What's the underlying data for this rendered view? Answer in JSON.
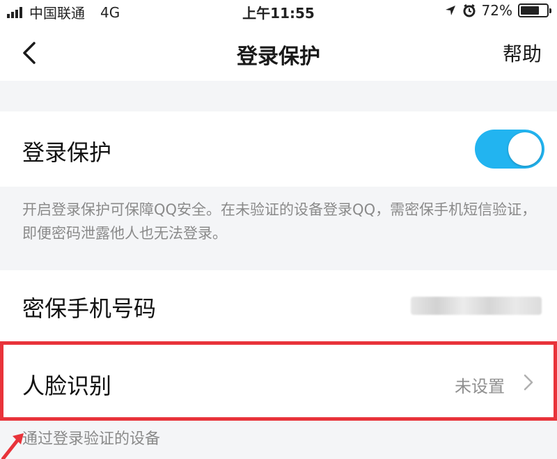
{
  "status": {
    "carrier": "中国联通",
    "network": "4G",
    "time": "上午11:55",
    "battery": "72%",
    "battery_level": 72
  },
  "nav": {
    "title": "登录保护",
    "help": "帮助"
  },
  "login_protect": {
    "label": "登录保护",
    "enabled": true,
    "description": "开启登录保护可保障QQ安全。在未验证的设备登录QQ，需密保手机短信验证，即便密码泄露他人也无法登录。"
  },
  "phone": {
    "label": "密保手机号码"
  },
  "face": {
    "label": "人脸识别",
    "value": "未设置"
  },
  "footer": {
    "devices_label": "通过登录验证的设备"
  },
  "colors": {
    "accent": "#22b4f0",
    "highlight": "#e8333a"
  }
}
